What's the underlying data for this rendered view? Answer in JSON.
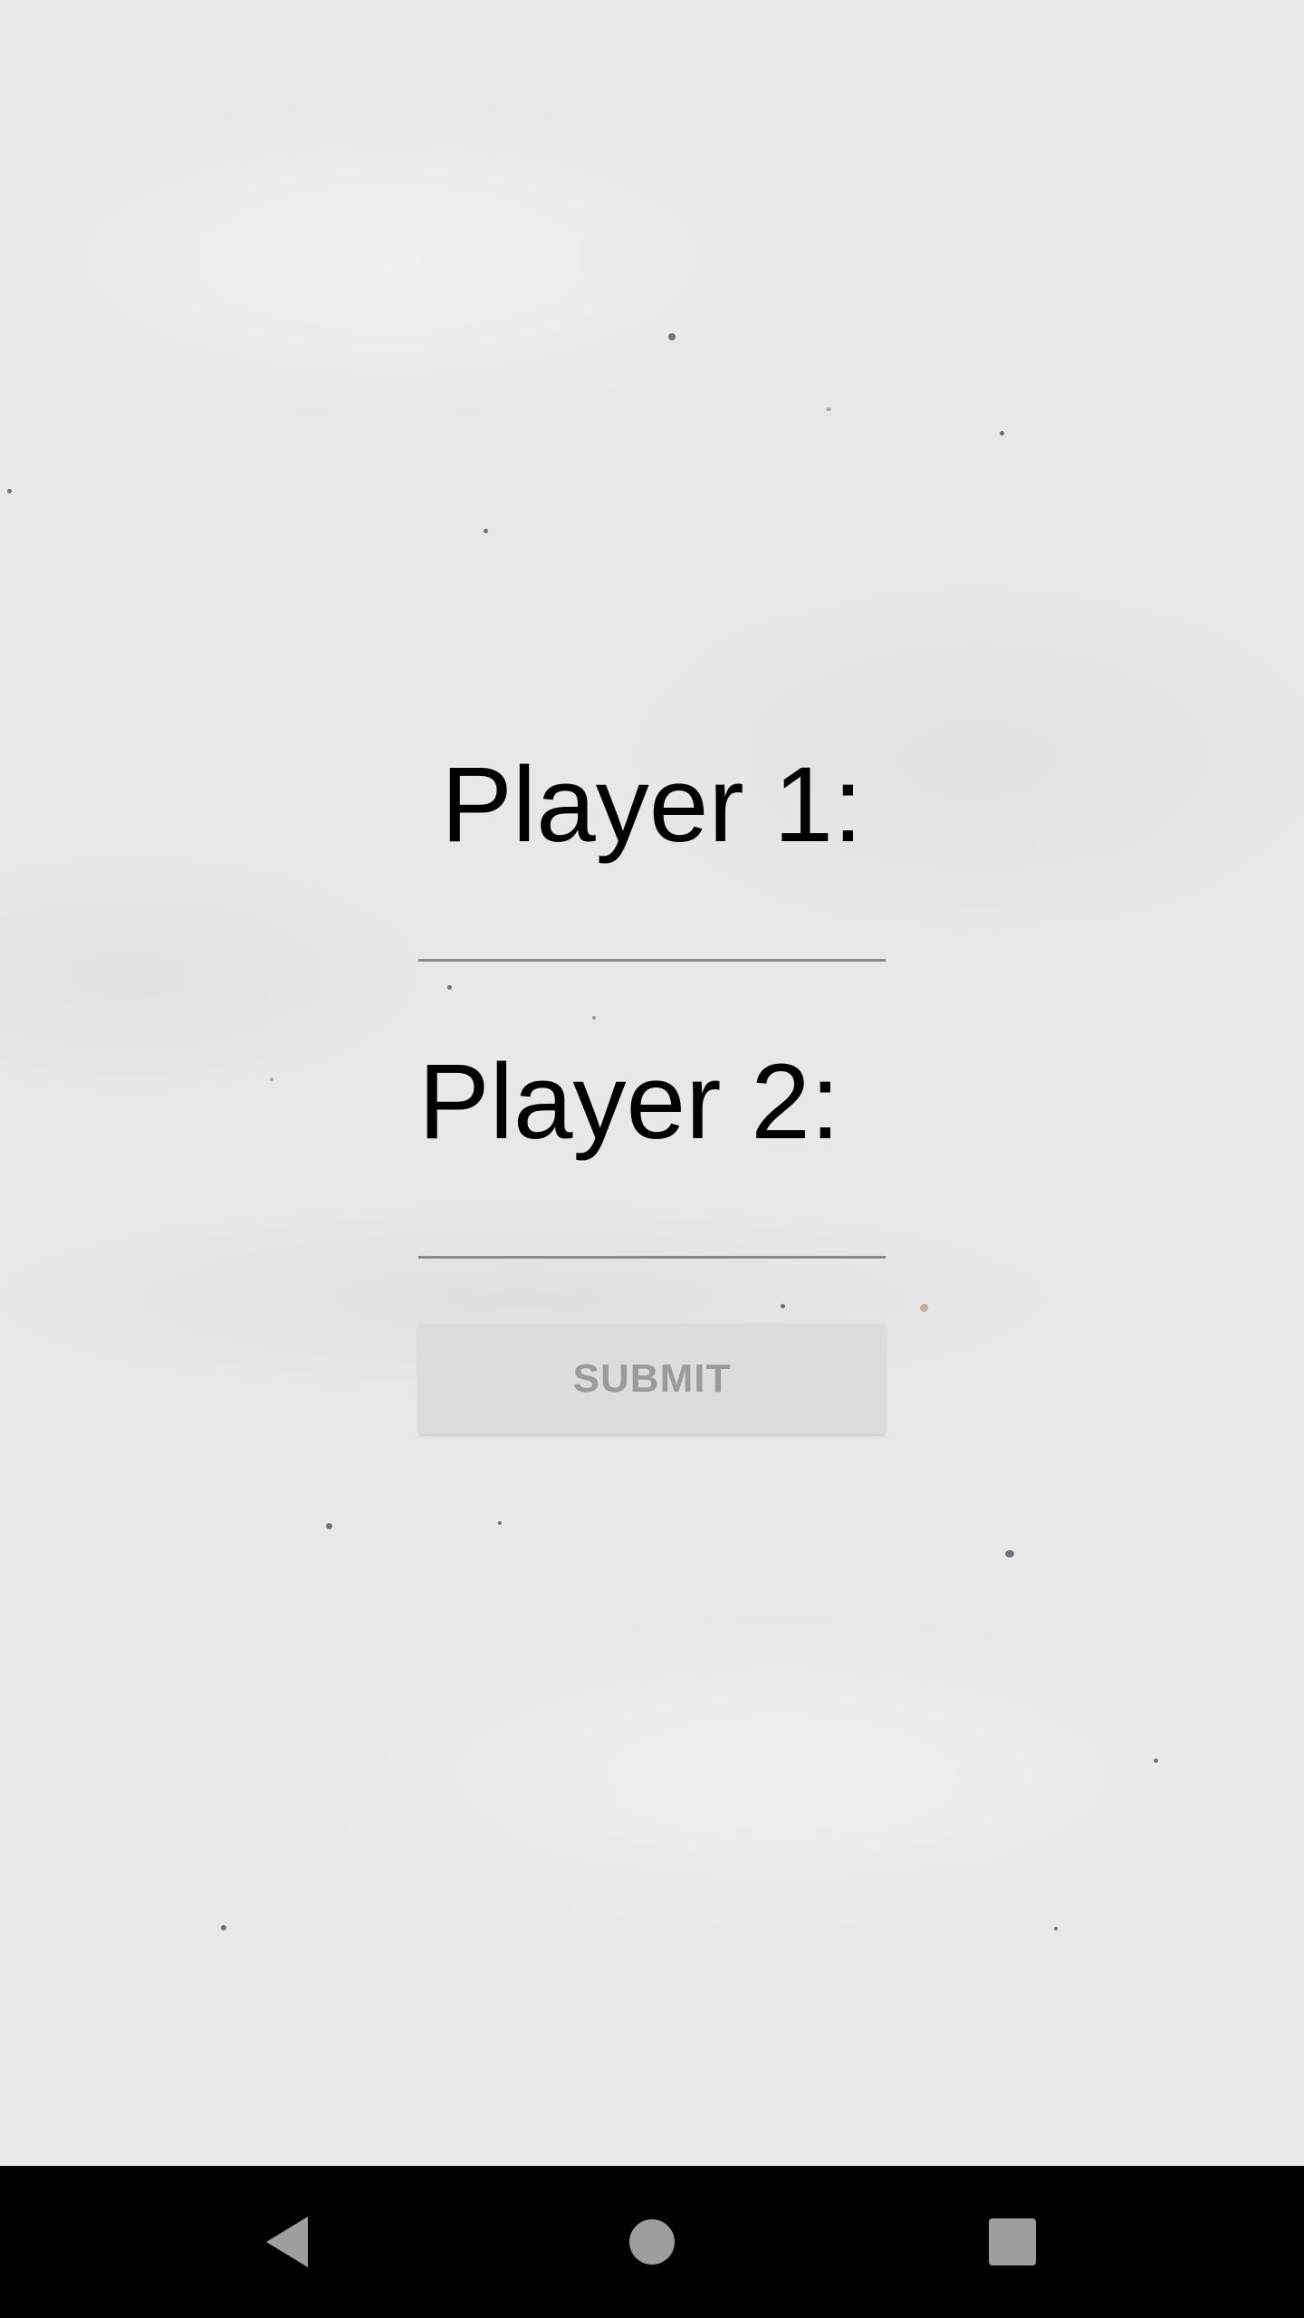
{
  "form": {
    "player1_label": "Player 1:",
    "player1_value": "",
    "player2_label": "Player 2:",
    "player2_value": "",
    "submit_label": "SUBMIT"
  },
  "navbar": {
    "back_icon": "back-triangle-icon",
    "home_icon": "home-circle-icon",
    "recents_icon": "recents-square-icon",
    "icon_color": "#9e9e9e"
  },
  "colors": {
    "background": "#e8e8e9",
    "label_text": "#000000",
    "underline": "#8a8a8a",
    "button_bg": "#dcdcdc",
    "button_text": "#9b9b9b",
    "navbar_bg": "#000000"
  }
}
